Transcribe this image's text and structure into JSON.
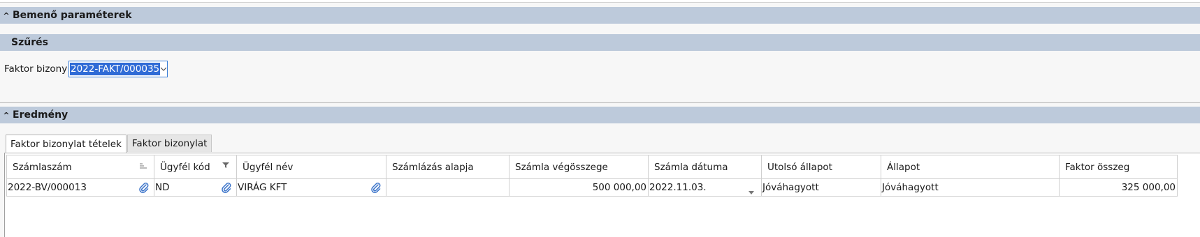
{
  "sections": {
    "input_params": "Bemenő paraméterek",
    "filter": "Szűrés",
    "result": "Eredmény"
  },
  "filter": {
    "label": "Faktor bizony",
    "value": "2022-FAKT/000035"
  },
  "tabs": [
    {
      "label": "Faktor bizonylat tételek",
      "active": true
    },
    {
      "label": "Faktor bizonylat",
      "active": false
    }
  ],
  "table": {
    "columns": [
      "Számlaszám",
      "Ügyfél kód",
      "Ügyfél név",
      "Számlázás alapja",
      "Számla végösszege",
      "Számla dátuma",
      "Utolsó állapot",
      "Állapot",
      "Faktor összeg"
    ],
    "rows": [
      [
        "2022-BV/000013",
        "ND",
        "VIRÁG KFT",
        "",
        "500 000,00",
        "2022.11.03.",
        "Jóváhagyott",
        "Jóváhagyott",
        "325 000,00"
      ]
    ]
  },
  "icons": {
    "collapse": "caret-up-icon",
    "sort": "sort-lines-icon",
    "filter": "funnel-icon",
    "attachment": "paperclip-icon",
    "dropdown": "chevron-down-icon"
  },
  "colors": {
    "section_bar": "#bdcadb",
    "selection": "#2f6bd6",
    "attachment": "#3a73c9"
  }
}
